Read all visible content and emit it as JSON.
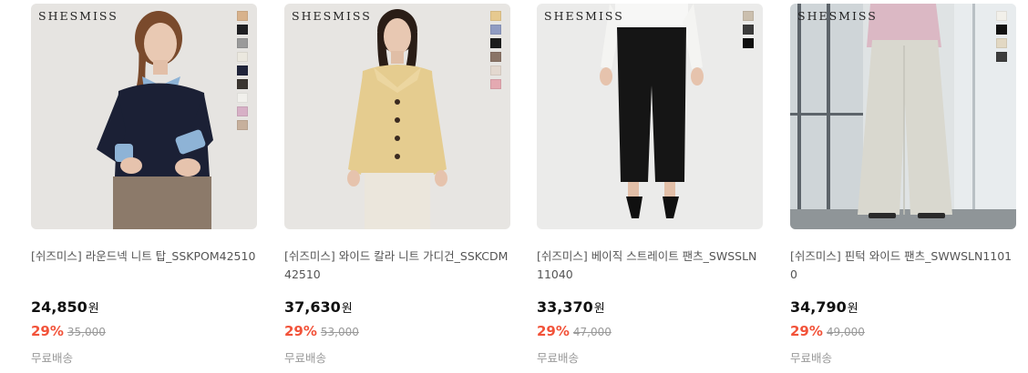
{
  "products": [
    {
      "brand": "SHESMISS",
      "title": "[쉬즈미스] 라운드넥 니트 탑_SSKPOM42510",
      "price": "24,850",
      "currency": "원",
      "discount": "29%",
      "original_price": "35,000",
      "shipping": "무료배송",
      "bg_color": "#e6e4e1",
      "swatches": [
        "#d8b28c",
        "#1f1f22",
        "#9a9a9a",
        "#ebe8df",
        "#20243a",
        "#3a3530",
        "#f1f0ec",
        "#d7b0c6",
        "#c7b09c"
      ]
    },
    {
      "brand": "SHESMISS",
      "title": "[쉬즈미스] 와이드 칼라 니트 가디건_SSKCDM42510",
      "price": "37,630",
      "currency": "원",
      "discount": "29%",
      "original_price": "53,000",
      "shipping": "무료배송",
      "bg_color": "#e7e5e2",
      "swatches": [
        "#e6c98f",
        "#8f9bc2",
        "#1c1c1c",
        "#8a7466",
        "#e3d8cf",
        "#e4a9b1"
      ]
    },
    {
      "brand": "SHESMISS",
      "title": "[쉬즈미스] 베이직 스트레이트 팬츠_SWSSLN11040",
      "price": "33,370",
      "currency": "원",
      "discount": "29%",
      "original_price": "47,000",
      "shipping": "무료배송",
      "bg_color": "#ebebea",
      "swatches": [
        "#cbbfae",
        "#3c3c3c",
        "#0f0f0f"
      ]
    },
    {
      "brand": "SHESMISS",
      "title": "[쉬즈미스] 핀턱 와이드 팬츠_SWWSLN11010",
      "price": "34,790",
      "currency": "원",
      "discount": "29%",
      "original_price": "49,000",
      "shipping": "무료배송",
      "bg_color": "#dfe3e4",
      "swatches": [
        "#f2f0ea",
        "#111111",
        "#e2d8c3",
        "#3d3d3d"
      ]
    }
  ]
}
